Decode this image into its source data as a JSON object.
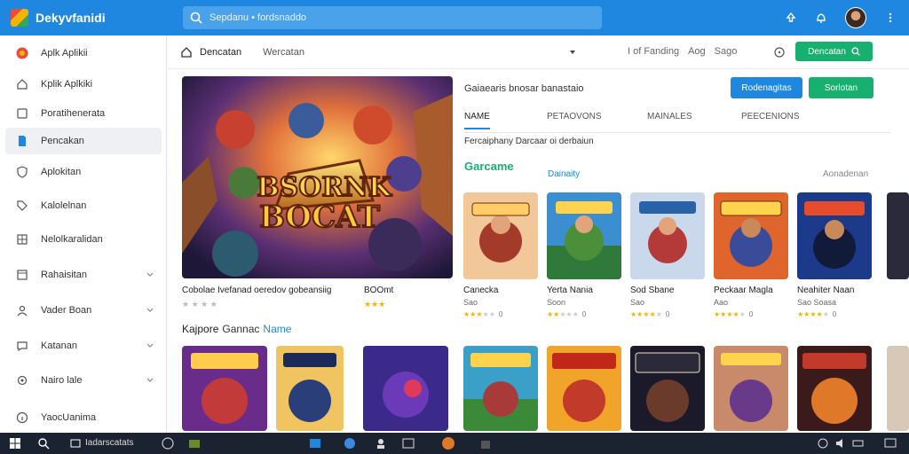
{
  "app": {
    "name": "Dekyvfanidi"
  },
  "search": {
    "placeholder": "Sepdanu • fordsnaddo"
  },
  "sidebar": {
    "items": [
      {
        "label": "Aplk Aplikii",
        "icon": "app-logo-icon"
      },
      {
        "label": "Kplik Aplkiki",
        "icon": "home-icon"
      },
      {
        "label": "Poratihenerata",
        "icon": "tablet-icon"
      },
      {
        "label": "Pencakan",
        "icon": "document-icon"
      },
      {
        "label": "Aplokitan",
        "icon": "shield-icon"
      },
      {
        "label": "Kalolelnan",
        "icon": "tag-icon"
      },
      {
        "label": "Nelolkaralidan",
        "icon": "grid-icon"
      },
      {
        "label": "Rahaisitan",
        "icon": "window-icon"
      },
      {
        "label": "Vader Boan",
        "icon": "person-icon"
      },
      {
        "label": "Katanan",
        "icon": "chat-icon"
      },
      {
        "label": "Nairo lale",
        "icon": "gear-icon"
      },
      {
        "label": "YaocUanima",
        "icon": "info-icon"
      }
    ]
  },
  "breadcrumb": {
    "home": "Dencatan",
    "second": "Wercatan",
    "links": [
      "I of Fanding",
      "Aog",
      "Sago"
    ],
    "action": "Dencatan"
  },
  "hero": {
    "logo_text": "BSORNK\nBOCAT",
    "caption": "Cobolae Ivefanad oeredov gobeansiig",
    "caption_right": "BOOmt"
  },
  "section": {
    "title": "Gaiaearis bnosar banastaio",
    "btn_blue": "Rodenagitas",
    "btn_green": "Sorlotan",
    "tabs": [
      "NAME",
      "PETAOVONS",
      "MAINALES",
      "PEECENIONS"
    ],
    "desc": "Fercaiphany Darcaar oi derbaiun",
    "games_title": "Garcame",
    "games_sub": "Dainaity",
    "see_all": "Aonadenan"
  },
  "games": [
    {
      "title": "Canecka",
      "sub": "Sao",
      "rating": 3,
      "count": "0"
    },
    {
      "title": "Yerta Nania",
      "sub": "Soon",
      "rating": 2,
      "count": "0"
    },
    {
      "title": "Sod Sbane",
      "sub": "Sao",
      "rating": 4,
      "count": "0"
    },
    {
      "title": "Peckaar Magla",
      "sub": "Aao",
      "rating": 4,
      "count": "0"
    },
    {
      "title": "Neahiter Naan",
      "sub": "Sao Soasa",
      "rating": 4,
      "count": "0"
    }
  ],
  "categories": {
    "title": "Kajpore",
    "green": "Gannac",
    "blue": "Name"
  },
  "taskbar": {
    "label": "Iadarscatats"
  },
  "colors": {
    "primary": "#1f87e0",
    "accent": "#18b06e",
    "taskbar": "#1b2330"
  }
}
